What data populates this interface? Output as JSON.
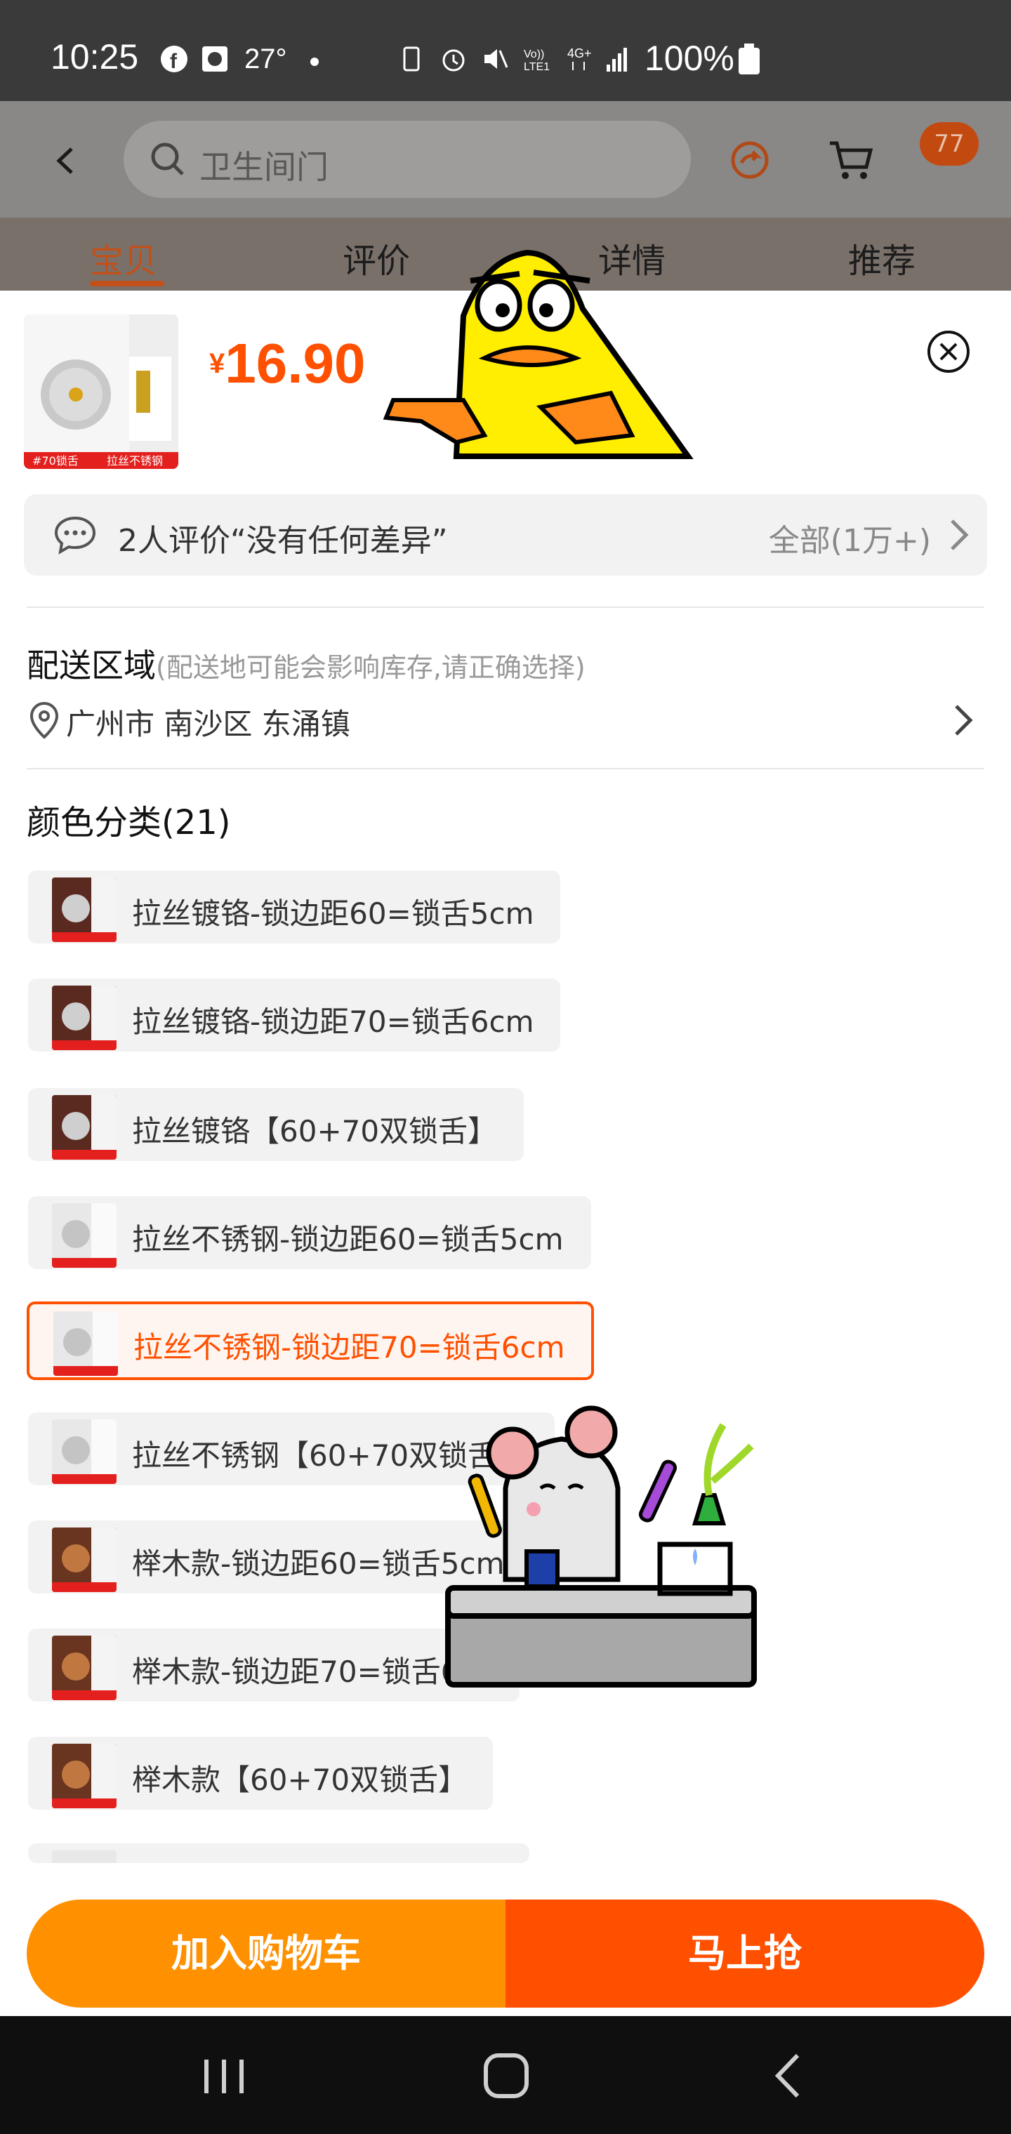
{
  "status_bar": {
    "time": "10:25",
    "temperature": "27°",
    "battery": "100%"
  },
  "header": {
    "search_placeholder": "卫生间门",
    "cart_badge": "77",
    "tabs": [
      {
        "label": "宝贝"
      },
      {
        "label": "评价"
      },
      {
        "label": "详情"
      },
      {
        "label": "推荐"
      }
    ]
  },
  "product": {
    "currency": "¥",
    "price": "16.90",
    "thumb_tag_left": "#70锁舌",
    "thumb_tag_right": "拉丝不锈钢"
  },
  "review": {
    "text": "2人评价“没有任何差异”",
    "all": "全部(1万+)"
  },
  "shipping": {
    "title": "配送区域",
    "note": "(配送地可能会影响库存,请正确选择)",
    "address": "广州市 南沙区 东涌镇"
  },
  "color": {
    "title": "颜色分类(21)",
    "options": [
      {
        "label": "拉丝镀铬-锁边距60=锁舌5cm"
      },
      {
        "label": "拉丝镀铬-锁边距70=锁舌6cm"
      },
      {
        "label": "拉丝镀铬【60+70双锁舌】"
      },
      {
        "label": "拉丝不锈钢-锁边距60=锁舌5cm"
      },
      {
        "label": "拉丝不锈钢-锁边距70=锁舌6cm"
      },
      {
        "label": "拉丝不锈钢【60+70双锁舌】"
      },
      {
        "label": "榉木款-锁边距60=锁舌5cm"
      },
      {
        "label": "榉木款-锁边距70=锁舌6cm"
      },
      {
        "label": "榉木款【60+70双锁舌】"
      }
    ]
  },
  "actions": {
    "add_to_cart": "加入购物车",
    "buy_now": "马上抢"
  },
  "colors": {
    "accent": "#ff5000",
    "cart_button": "#ff9000",
    "selected_border": "#ff5000"
  },
  "icons": [
    "back-icon",
    "search-icon",
    "share-icon",
    "cart-icon",
    "close-icon",
    "comment-icon",
    "chevron-right-icon",
    "location-icon",
    "recent-apps-icon",
    "home-icon",
    "nav-back-icon"
  ]
}
